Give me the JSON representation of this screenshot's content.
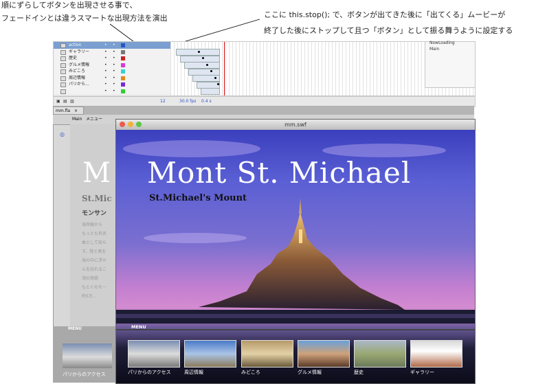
{
  "annotations": {
    "left_line1": "順にずらしてボタンを出現させる事で、",
    "left_line2": "フェードインとは違うスマートな出現方法を演出",
    "right_line1": "ここに this.stop(); で、ボタンが出てきた後に「出てくる」ムービーが",
    "right_line2": "終了した後にストップして且つ「ボタン」として振る舞うように設定する"
  },
  "timeline": {
    "layers": [
      {
        "name": "action",
        "color": "#2a55c4"
      },
      {
        "name": "ギャラリー",
        "color": "#777777"
      },
      {
        "name": "歴史",
        "color": "#cc2222"
      },
      {
        "name": "グルメ情報",
        "color": "#d63bd6"
      },
      {
        "name": "みどころ",
        "color": "#33d3d3"
      },
      {
        "name": "周辺情報",
        "color": "#e08a1a"
      },
      {
        "name": "パリから...",
        "color": "#7a2bd6"
      },
      {
        "name": "",
        "color": "#2fcf2f"
      }
    ],
    "fps": "30.0 fps",
    "time": "0.4 s",
    "frame": "12"
  },
  "library": {
    "item1": "NowLoading",
    "item2": "Main"
  },
  "ide": {
    "doc_tab": "mm.fla",
    "scene_main": "Main",
    "scene_menu": "メニュー",
    "stage_big_letter": "M",
    "stage_sub": "St.Mic",
    "stage_heading": "モンサン",
    "stage_para": [
      "海岸線から",
      "もっとも有名",
      "曲として知ら",
      "す。陸と島を",
      "海の中に浮か",
      "ルを訪れるこ",
      "湾の奇跡",
      "もとくのモー",
      "約5万…"
    ],
    "lower_menu": "MENU",
    "lower_caption": "パリからのアクセス"
  },
  "swf": {
    "window_title": "mm.swf",
    "title": "Mont St. Michael",
    "subtitle": "St.Michael's Mount",
    "menu_label": "MENU",
    "thumbs": [
      {
        "label": "パリからのアクセス"
      },
      {
        "label": "周辺情報"
      },
      {
        "label": "みどころ"
      },
      {
        "label": "グルメ情報"
      },
      {
        "label": "歴史"
      },
      {
        "label": "ギャラリー"
      }
    ]
  }
}
